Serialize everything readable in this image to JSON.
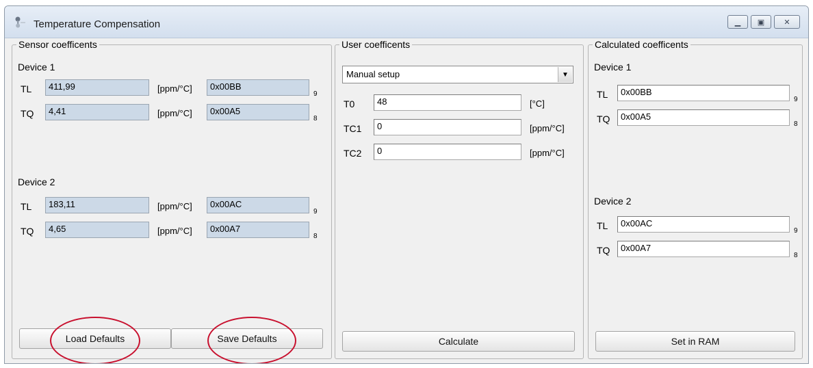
{
  "window": {
    "title": "Temperature Compensation",
    "icon": "thermometer-icon",
    "controls": [
      "minimize-icon",
      "maximize-icon",
      "close-icon"
    ]
  },
  "sensor": {
    "legend": "Sensor coefficents",
    "devices": [
      {
        "label": "Device 1",
        "rows": [
          {
            "name": "TL",
            "value": "411,99",
            "unit": "[ppm/°C]",
            "hex": "0x00BB",
            "sub": "9"
          },
          {
            "name": "TQ",
            "value": "4,41",
            "unit": "[ppm/°C]",
            "hex": "0x00A5",
            "sub": "8"
          }
        ]
      },
      {
        "label": "Device 2",
        "rows": [
          {
            "name": "TL",
            "value": "183,11",
            "unit": "[ppm/°C]",
            "hex": "0x00AC",
            "sub": "9"
          },
          {
            "name": "TQ",
            "value": "4,65",
            "unit": "[ppm/°C]",
            "hex": "0x00A7",
            "sub": "8"
          }
        ]
      }
    ],
    "load_label": "Load Defaults",
    "save_label": "Save Defaults"
  },
  "user": {
    "legend": "User coefficents",
    "mode": "Manual setup",
    "rows": [
      {
        "name": "T0",
        "value": "48",
        "unit": "[°C]"
      },
      {
        "name": "TC1",
        "value": "0",
        "unit": "[ppm/°C]"
      },
      {
        "name": "TC2",
        "value": "0",
        "unit": "[ppm/°C]"
      }
    ],
    "calculate_label": "Calculate"
  },
  "calculated": {
    "legend": "Calculated coefficents",
    "devices": [
      {
        "label": "Device 1",
        "rows": [
          {
            "name": "TL",
            "value": "0x00BB",
            "sub": "9"
          },
          {
            "name": "TQ",
            "value": "0x00A5",
            "sub": "8"
          }
        ]
      },
      {
        "label": "Device 2",
        "rows": [
          {
            "name": "TL",
            "value": "0x00AC",
            "sub": "9"
          },
          {
            "name": "TQ",
            "value": "0x00A7",
            "sub": "8"
          }
        ]
      }
    ],
    "set_label": "Set in RAM"
  },
  "colors": {
    "readonly_field": "#ccd9e7",
    "annotation_circle": "#c8102e"
  }
}
